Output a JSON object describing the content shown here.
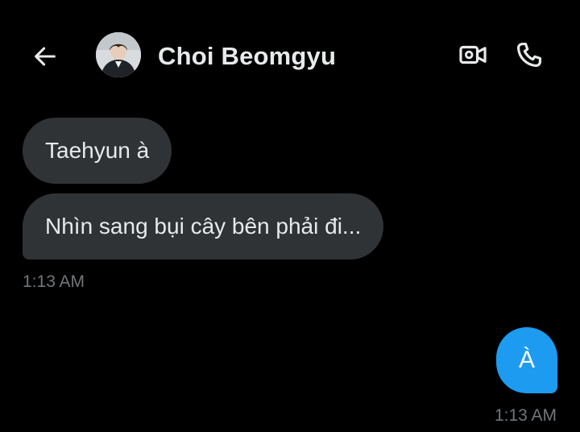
{
  "header": {
    "contact_name": "Choi Beomgyu",
    "back_icon": "arrow-left-icon",
    "video_icon": "video-camera-icon",
    "call_icon": "phone-icon"
  },
  "messages": [
    {
      "direction": "received",
      "text": "Taehyun à"
    },
    {
      "direction": "received",
      "text": "Nhìn sang bụi cây bên phải đi..."
    },
    {
      "direction": "sent",
      "text": "À"
    }
  ],
  "timestamps": {
    "received_group": "1:13 AM",
    "sent_group": "1:13 AM"
  },
  "colors": {
    "background": "#000000",
    "received_bubble": "#2f3336",
    "sent_bubble": "#1d9bf0",
    "text": "#e7e9ea",
    "muted": "#71767b"
  }
}
